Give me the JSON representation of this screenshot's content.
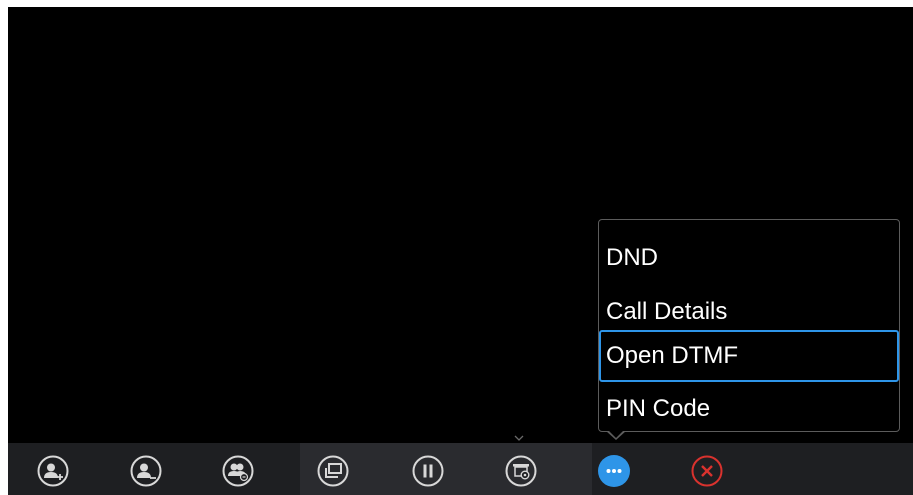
{
  "menu": {
    "items": [
      {
        "label": "DND",
        "selected": false
      },
      {
        "label": "Call Details",
        "selected": false
      },
      {
        "label": "Open DTMF",
        "selected": true
      },
      {
        "label": "PIN Code",
        "selected": false
      }
    ]
  },
  "toolbar": {
    "buttons": [
      {
        "icon": "add-participant-icon",
        "state": "default"
      },
      {
        "icon": "remove-participant-icon",
        "state": "default"
      },
      {
        "icon": "conference-members-icon",
        "state": "default"
      },
      {
        "icon": "layout-icon",
        "state": "default"
      },
      {
        "icon": "hold-icon",
        "state": "default"
      },
      {
        "icon": "presentation-icon",
        "state": "default"
      },
      {
        "icon": "more-icon",
        "state": "active"
      },
      {
        "icon": "end-call-icon",
        "state": "default"
      }
    ]
  },
  "colors": {
    "accent": "#2e95e8",
    "end_call": "#d9322e",
    "icon": "#d8d8d8",
    "toolbar_bg": "#1e1f22"
  }
}
